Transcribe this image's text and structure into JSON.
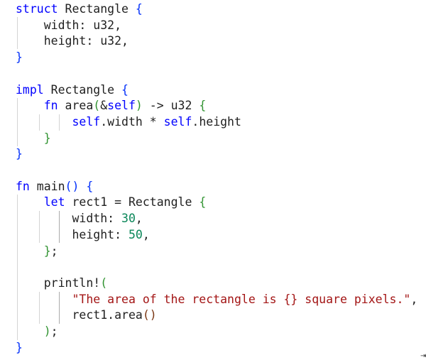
{
  "editor": {
    "language": "rust",
    "lines": [
      [
        {
          "t": "struct",
          "c": "kw"
        },
        {
          "t": " Rectangle ",
          "c": "plain"
        },
        {
          "t": "{",
          "c": "b1"
        }
      ],
      [
        {
          "t": "    width: u32,",
          "c": "plain"
        }
      ],
      [
        {
          "t": "    height: u32,",
          "c": "plain"
        }
      ],
      [
        {
          "t": "}",
          "c": "b1"
        }
      ],
      [],
      [
        {
          "t": "impl",
          "c": "kw"
        },
        {
          "t": " Rectangle ",
          "c": "plain"
        },
        {
          "t": "{",
          "c": "b1"
        }
      ],
      [
        {
          "t": "    ",
          "c": "plain"
        },
        {
          "t": "fn",
          "c": "kw"
        },
        {
          "t": " area",
          "c": "plain"
        },
        {
          "t": "(",
          "c": "b2"
        },
        {
          "t": "&",
          "c": "plain"
        },
        {
          "t": "self",
          "c": "kw"
        },
        {
          "t": ")",
          "c": "b2"
        },
        {
          "t": " -> u32 ",
          "c": "plain"
        },
        {
          "t": "{",
          "c": "b2"
        }
      ],
      [
        {
          "t": "        ",
          "c": "plain"
        },
        {
          "t": "self",
          "c": "kw"
        },
        {
          "t": ".width * ",
          "c": "plain"
        },
        {
          "t": "self",
          "c": "kw"
        },
        {
          "t": ".height",
          "c": "plain"
        }
      ],
      [
        {
          "t": "    }",
          "c": "b2"
        }
      ],
      [
        {
          "t": "}",
          "c": "b1"
        }
      ],
      [],
      [
        {
          "t": "fn",
          "c": "kw"
        },
        {
          "t": " main",
          "c": "plain"
        },
        {
          "t": "()",
          "c": "b1"
        },
        {
          "t": " ",
          "c": "plain"
        },
        {
          "t": "{",
          "c": "b1"
        }
      ],
      [
        {
          "t": "    ",
          "c": "plain"
        },
        {
          "t": "let",
          "c": "kw"
        },
        {
          "t": " rect1 = Rectangle ",
          "c": "plain"
        },
        {
          "t": "{",
          "c": "b2"
        }
      ],
      [
        {
          "t": "        width: ",
          "c": "plain"
        },
        {
          "t": "30",
          "c": "num"
        },
        {
          "t": ",",
          "c": "plain"
        }
      ],
      [
        {
          "t": "        height: ",
          "c": "plain"
        },
        {
          "t": "50",
          "c": "num"
        },
        {
          "t": ",",
          "c": "plain"
        }
      ],
      [
        {
          "t": "    }",
          "c": "b2"
        },
        {
          "t": ";",
          "c": "plain"
        }
      ],
      [],
      [
        {
          "t": "    println!",
          "c": "plain"
        },
        {
          "t": "(",
          "c": "b2"
        }
      ],
      [
        {
          "t": "        ",
          "c": "plain"
        },
        {
          "t": "\"The area of the rectangle is {} square pixels.\"",
          "c": "str"
        },
        {
          "t": ",",
          "c": "plain"
        }
      ],
      [
        {
          "t": "        rect1.area",
          "c": "plain"
        },
        {
          "t": "()",
          "c": "b3"
        }
      ],
      [
        {
          "t": "    )",
          "c": "b2"
        },
        {
          "t": ";",
          "c": "plain"
        }
      ],
      [
        {
          "t": "}",
          "c": "b1"
        }
      ]
    ]
  },
  "colors": {
    "keyword": "#0000ff",
    "number": "#098658",
    "string": "#a31515",
    "bracket_level_1": "#0431fa",
    "bracket_level_2": "#319331",
    "bracket_level_3": "#7b3814",
    "text": "#1f1f1f",
    "indent_guide": "#d4d4d4",
    "background": "#ffffff"
  },
  "status": {
    "corner_glyph": "⇥"
  }
}
